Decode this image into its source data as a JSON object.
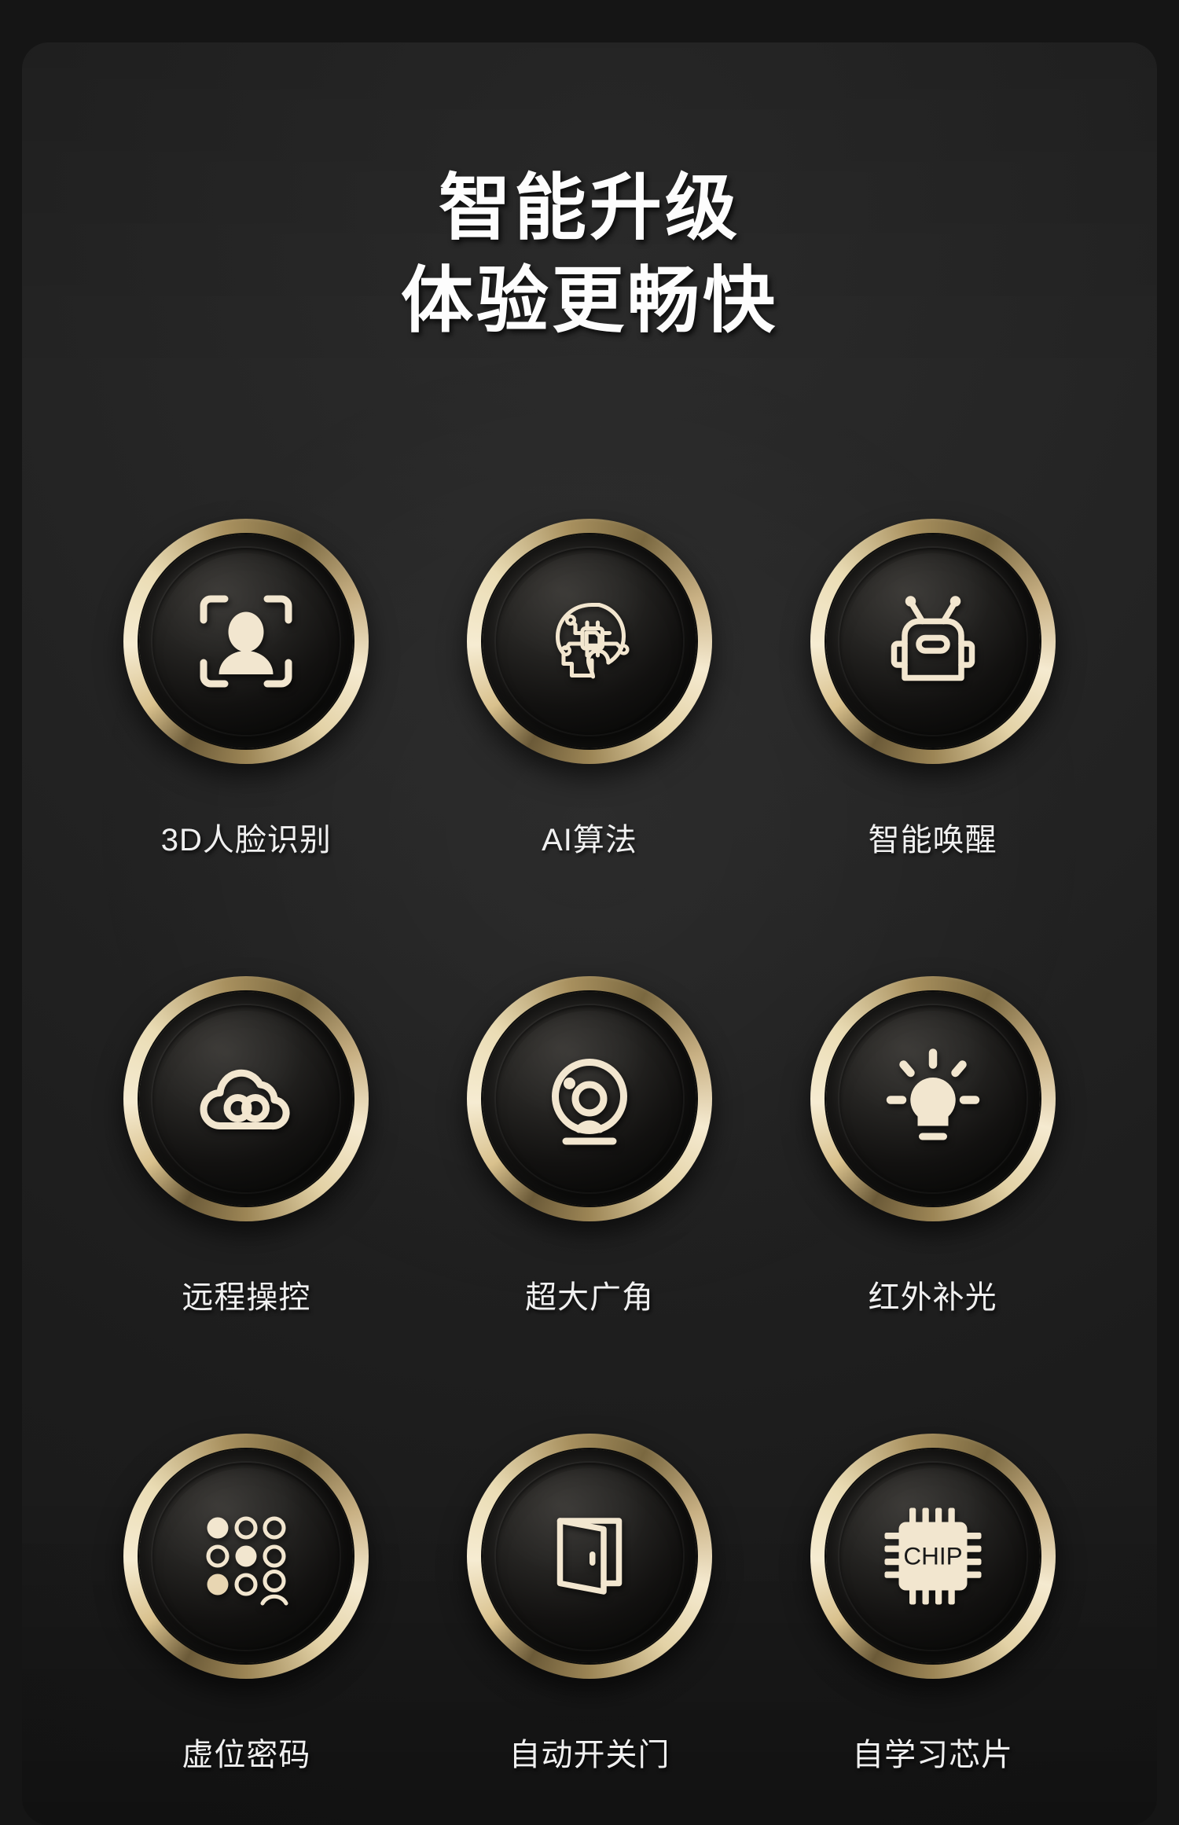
{
  "page": {
    "background_color": "#151515",
    "panel_color": "#242424",
    "gold_color": "#e9d7a6",
    "icon_color": "#f2e6cf",
    "text_color": "#f0f0f0"
  },
  "heading": {
    "line1": "智能升级",
    "line2": "体验更畅快"
  },
  "features": [
    {
      "icon": "face-scan-icon",
      "label": "3D人脸识别"
    },
    {
      "icon": "ai-brain-chip-icon",
      "label": "AI算法"
    },
    {
      "icon": "robot-head-icon",
      "label": "智能唤醒"
    },
    {
      "icon": "cloud-remote-icon",
      "label": "远程操控"
    },
    {
      "icon": "webcam-icon",
      "label": "超大广角"
    },
    {
      "icon": "light-bulb-icon",
      "label": "红外补光"
    },
    {
      "icon": "keypad-dots-icon",
      "label": "虚位密码"
    },
    {
      "icon": "open-door-icon",
      "label": "自动开关门"
    },
    {
      "icon": "chip-icon",
      "label": "自学习芯片"
    }
  ],
  "chip_icon_text": "CHIP"
}
